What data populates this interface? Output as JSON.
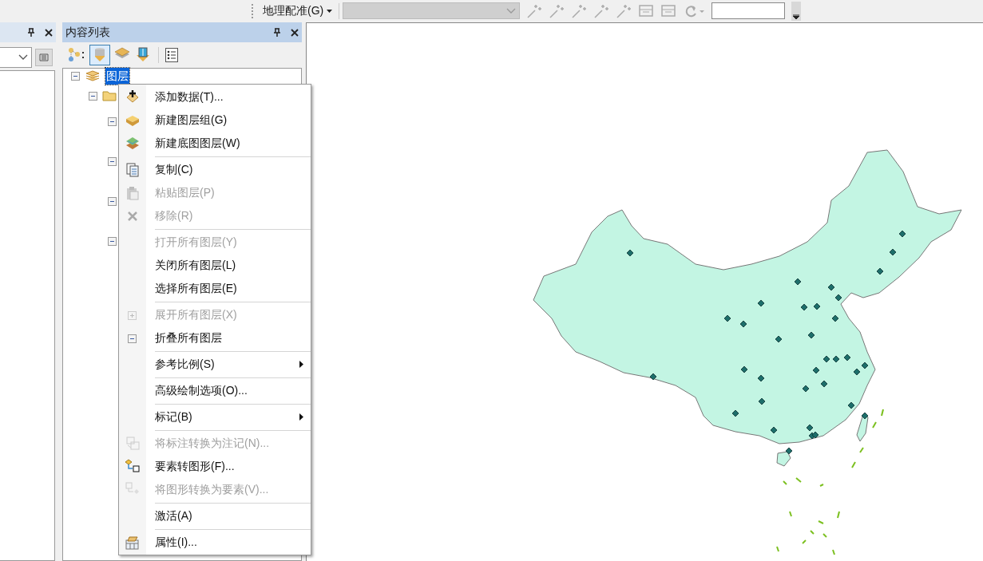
{
  "toolbar": {
    "menu": "地理配准(G)",
    "layer_combo": {
      "disabled": true
    }
  },
  "toc": {
    "title": "内容列表",
    "root": {
      "label": "图层",
      "selected": true,
      "expanded": true
    }
  },
  "context_menu": [
    {
      "kind": "item",
      "label": "添加数据(T)...",
      "disabled": false
    },
    {
      "kind": "item",
      "label": "新建图层组(G)",
      "disabled": false
    },
    {
      "kind": "item",
      "label": "新建底图图层(W)",
      "disabled": false
    },
    {
      "kind": "separator"
    },
    {
      "kind": "item",
      "label": "复制(C)",
      "disabled": false
    },
    {
      "kind": "item",
      "label": "粘贴图层(P)",
      "disabled": true
    },
    {
      "kind": "item",
      "label": "移除(R)",
      "disabled": true
    },
    {
      "kind": "separator"
    },
    {
      "kind": "item",
      "label": "打开所有图层(Y)",
      "disabled": true
    },
    {
      "kind": "item",
      "label": "关闭所有图层(L)",
      "disabled": false
    },
    {
      "kind": "item",
      "label": "选择所有图层(E)",
      "disabled": false
    },
    {
      "kind": "separator"
    },
    {
      "kind": "item",
      "label": "展开所有图层(X)",
      "disabled": true
    },
    {
      "kind": "item",
      "label": "折叠所有图层",
      "disabled": false
    },
    {
      "kind": "separator"
    },
    {
      "kind": "submenu",
      "label": "参考比例(S)",
      "disabled": false
    },
    {
      "kind": "separator"
    },
    {
      "kind": "item",
      "label": "高级绘制选项(O)...",
      "disabled": false
    },
    {
      "kind": "separator"
    },
    {
      "kind": "submenu",
      "label": "标记(B)",
      "disabled": false
    },
    {
      "kind": "separator"
    },
    {
      "kind": "item",
      "label": "将标注转换为注记(N)...",
      "disabled": true
    },
    {
      "kind": "item",
      "label": "要素转图形(F)...",
      "disabled": false
    },
    {
      "kind": "item",
      "label": "将图形转换为要素(V)...",
      "disabled": true
    },
    {
      "kind": "separator"
    },
    {
      "kind": "item",
      "label": "激活(A)",
      "disabled": false
    },
    {
      "kind": "separator"
    },
    {
      "kind": "item",
      "label": "属性(I)...",
      "disabled": false
    }
  ]
}
